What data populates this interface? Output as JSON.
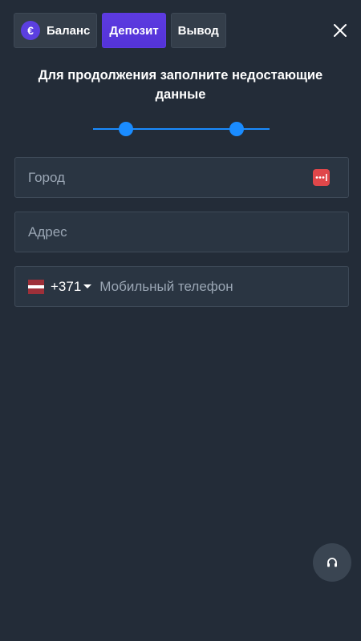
{
  "tabs": {
    "balance_label": "Баланс",
    "deposit_label": "Депозит",
    "withdraw_label": "Вывод",
    "currency_symbol": "€"
  },
  "form": {
    "title": "Для продолжения заполните недостающие данные",
    "steps_total": 2,
    "city": {
      "placeholder": "Город",
      "value": ""
    },
    "address": {
      "placeholder": "Адрес",
      "value": ""
    },
    "phone": {
      "country_code": "+371",
      "placeholder": "Мобильный телефон",
      "value": ""
    }
  },
  "icons": {
    "close": "close-icon",
    "euro": "euro-icon",
    "autofill": "autofill-icon",
    "flag": "latvia-flag-icon",
    "caret": "caret-down-icon",
    "support": "headset-icon"
  },
  "colors": {
    "background": "#232c38",
    "tab_active": "#5433d8",
    "accent": "#1a8cff",
    "field_bg": "#2a3542",
    "support_bg": "#3a4552"
  }
}
